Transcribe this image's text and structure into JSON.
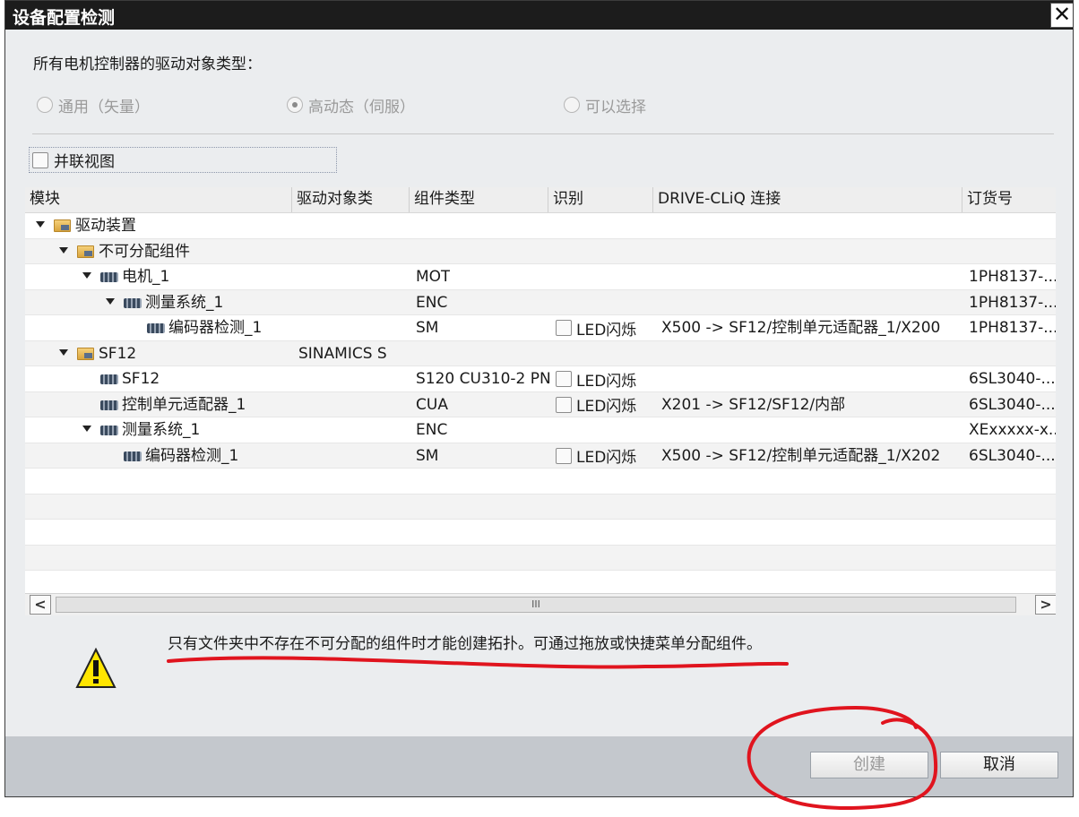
{
  "dialog": {
    "title": "设备配置检测",
    "close_glyph": "✕"
  },
  "section": {
    "label": "所有电机控制器的驱动对象类型：",
    "radios": [
      {
        "label": "通用（矢量）",
        "selected": false
      },
      {
        "label": "高动态（伺服）",
        "selected": true
      },
      {
        "label": "可以选择",
        "selected": false
      }
    ]
  },
  "parallel_view": {
    "label": "并联视图",
    "checked": false
  },
  "table": {
    "columns": [
      "模块",
      "驱动对象类",
      "组件类型",
      "识别",
      "DRIVE-CLiQ 连接",
      "订货号"
    ],
    "rows": [
      {
        "level": 0,
        "expand": true,
        "icon": "folder-icon",
        "module": "驱动装置",
        "drive_object": "",
        "type": "",
        "led": "",
        "conn": "",
        "order": ""
      },
      {
        "level": 1,
        "expand": true,
        "icon": "folder-icon",
        "module": "不可分配组件",
        "drive_object": "",
        "type": "",
        "led": "",
        "conn": "",
        "order": ""
      },
      {
        "level": 2,
        "expand": true,
        "icon": "device-icon",
        "module": "电机_1",
        "drive_object": "",
        "type": "MOT",
        "led": "",
        "conn": "",
        "order": "1PH8137-..."
      },
      {
        "level": 3,
        "expand": true,
        "icon": "device-icon",
        "module": "测量系统_1",
        "drive_object": "",
        "type": "ENC",
        "led": "",
        "conn": "",
        "order": "1PH8137-..."
      },
      {
        "level": 4,
        "expand": false,
        "icon": "device-icon",
        "module": "编码器检测_1",
        "drive_object": "",
        "type": "SM",
        "led": "LED闪烁",
        "conn": "X500 -> SF12/控制单元适配器_1/X200",
        "order": "1PH8137-..."
      },
      {
        "level": 1,
        "expand": true,
        "icon": "folder-icon",
        "module": "SF12",
        "drive_object": "SINAMICS S",
        "type": "",
        "led": "",
        "conn": "",
        "order": ""
      },
      {
        "level": 2,
        "expand": false,
        "icon": "device-icon",
        "module": "SF12",
        "drive_object": "",
        "type": "S120 CU310-2 PN",
        "led": "LED闪烁",
        "conn": "",
        "order": "6SL3040-..."
      },
      {
        "level": 2,
        "expand": false,
        "icon": "device-icon",
        "module": "控制单元适配器_1",
        "drive_object": "",
        "type": "CUA",
        "led": "LED闪烁",
        "conn": "X201 -> SF12/SF12/内部",
        "order": "6SL3040-..."
      },
      {
        "level": 2,
        "expand": true,
        "icon": "device-icon",
        "module": "测量系统_1",
        "drive_object": "",
        "type": "ENC",
        "led": "",
        "conn": "",
        "order": "XExxxxx-x..."
      },
      {
        "level": 3,
        "expand": false,
        "icon": "device-icon",
        "module": "编码器检测_1",
        "drive_object": "",
        "type": "SM",
        "led": "LED闪烁",
        "conn": "X500 -> SF12/控制单元适配器_1/X202",
        "order": "6SL3040-..."
      }
    ],
    "scroll_grip": "III"
  },
  "warning": {
    "text": "只有文件夹中不存在不可分配的组件时才能创建拓扑。可通过拖放或快捷菜单分配组件。"
  },
  "buttons": {
    "create": "创建",
    "cancel": "取消"
  },
  "colors": {
    "annotation": "#e0141e",
    "title_bar": "#1c1c1c",
    "bottom_bar": "#c4c8cd"
  }
}
